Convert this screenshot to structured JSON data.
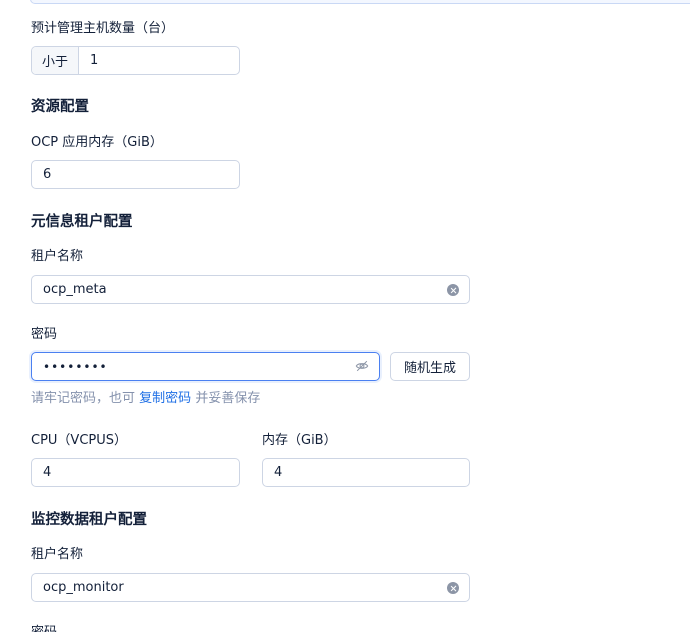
{
  "host_count": {
    "label": "预计管理主机数量（台）",
    "addon": "小于",
    "value": "1"
  },
  "resource": {
    "title": "资源配置",
    "memory_label": "OCP 应用内存（GiB）",
    "memory_value": "6"
  },
  "meta_tenant": {
    "title": "元信息租户配置",
    "name_label": "租户名称",
    "name_value": "ocp_meta",
    "password_label": "密码",
    "password_value": "••••••••",
    "generate_button": "随机生成",
    "hint_prefix": "请牢记密码，也可",
    "hint_link": "复制密码",
    "hint_suffix": "并妥善保存",
    "cpu_label": "CPU（VCPUS）",
    "cpu_value": "4",
    "memory_label": "内存（GiB）",
    "memory_value": "4"
  },
  "monitor_tenant": {
    "title": "监控数据租户配置",
    "name_label": "租户名称",
    "name_value": "ocp_monitor",
    "password_label": "密码"
  }
}
